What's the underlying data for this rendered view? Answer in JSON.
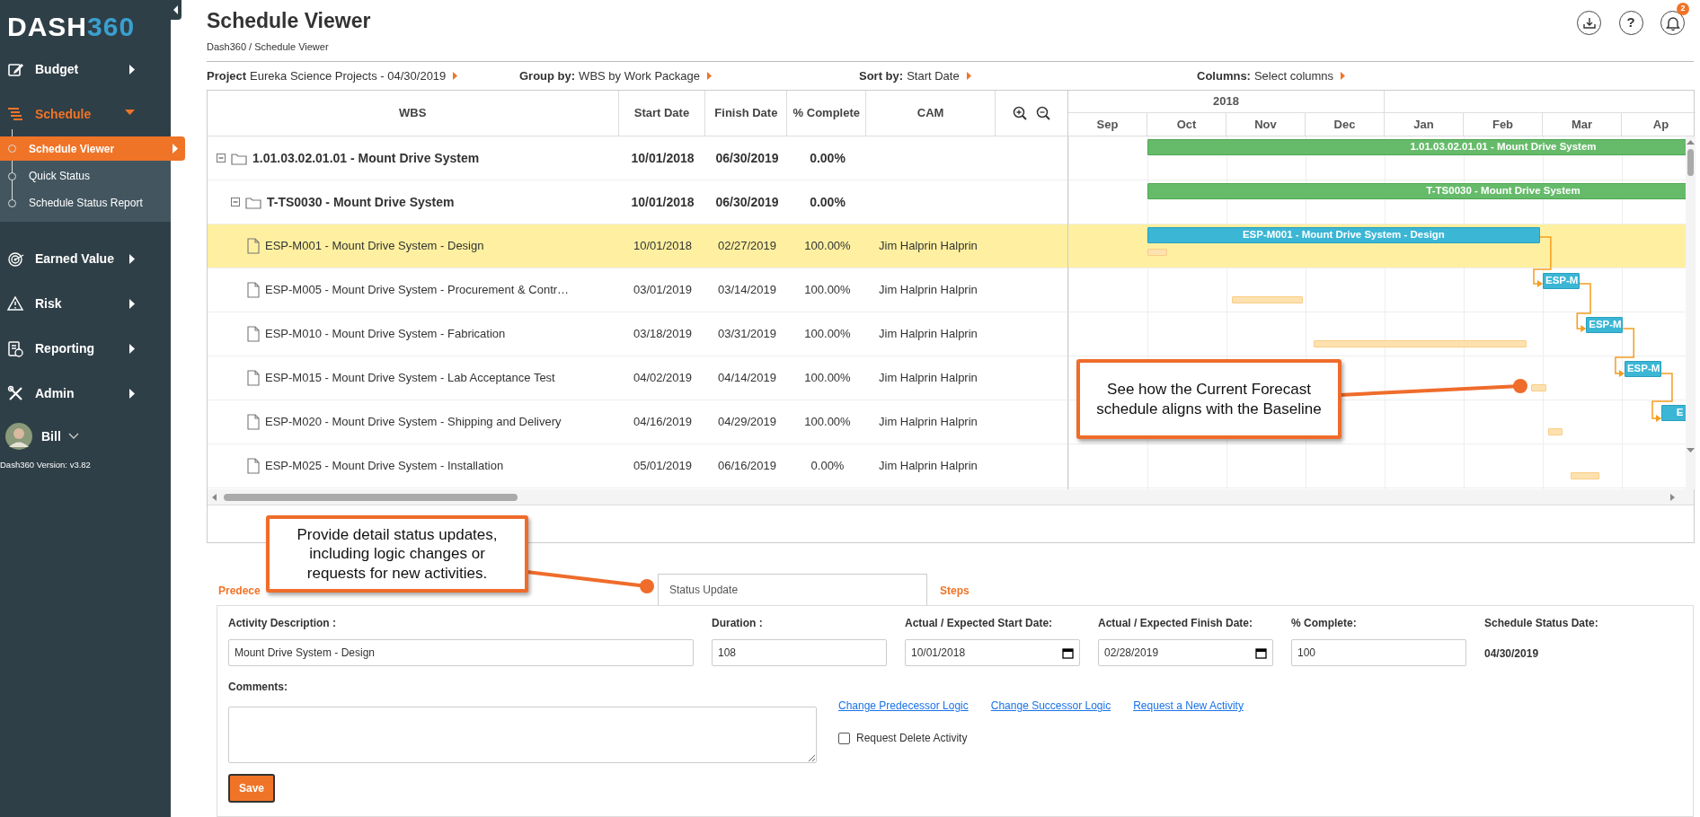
{
  "sidebar": {
    "logo": {
      "text": "DASH",
      "accent": "360"
    },
    "items": [
      {
        "label": "Budget",
        "expanded": false
      },
      {
        "label": "Schedule",
        "expanded": true,
        "children": [
          {
            "label": "Schedule Viewer",
            "selected": true
          },
          {
            "label": "Quick Status",
            "selected": false
          },
          {
            "label": "Schedule Status Report",
            "selected": false
          }
        ]
      },
      {
        "label": "Earned Value",
        "expanded": false
      },
      {
        "label": "Risk",
        "expanded": false
      },
      {
        "label": "Reporting",
        "expanded": false
      },
      {
        "label": "Admin",
        "expanded": false
      }
    ],
    "user": {
      "name": "Bill"
    },
    "version": "Dash360 Version: v3.82"
  },
  "header": {
    "title": "Schedule Viewer",
    "breadcrumb": "Dash360 / Schedule Viewer",
    "help": "?",
    "notification_count": "2"
  },
  "toolbar": [
    {
      "label": "Project",
      "value": "Eureka Science Projects - 04/30/2019"
    },
    {
      "label": "Group by:",
      "value": "WBS by Work Package"
    },
    {
      "label": "Sort by:",
      "value": "Start Date"
    },
    {
      "label": "Columns:",
      "value": "Select columns"
    }
  ],
  "grid": {
    "columns": [
      "WBS",
      "Start Date",
      "Finish Date",
      "% Complete",
      "CAM"
    ],
    "timeline": {
      "year": "2018",
      "months": [
        "Sep",
        "Oct",
        "Nov",
        "Dec",
        "Jan",
        "Feb",
        "Mar",
        "Ap"
      ]
    },
    "rows": [
      {
        "kind": "group",
        "wbs": "1.01.03.02.01.01 - Mount Drive System",
        "start": "10/01/2018",
        "finish": "06/30/2019",
        "complete": "0.00%",
        "expanded": true,
        "selected": false,
        "bar_label": "1.01.03.02.01.01 - Mount Drive System",
        "children": [
          {
            "kind": "group",
            "wbs": "T-TS0030 - Mount Drive System",
            "start": "10/01/2018",
            "finish": "06/30/2019",
            "complete": "0.00%",
            "expanded": true,
            "selected": false,
            "bar_label": "T-TS0030 - Mount Drive System",
            "children": [
              {
                "kind": "task",
                "wbs": "ESP-M001 - Mount Drive System - Design",
                "start": "10/01/2018",
                "finish": "02/27/2019",
                "complete": "100.00%",
                "cam": "Jim Halprin Halprin",
                "selected": true,
                "bar_label": "ESP-M001 - Mount Drive System - Design"
              },
              {
                "kind": "task",
                "wbs": "ESP-M005 - Mount Drive System - Procurement & Contr…",
                "start": "03/01/2019",
                "finish": "03/14/2019",
                "complete": "100.00%",
                "cam": "Jim Halprin Halprin",
                "selected": false,
                "bar_label": "ESP-M"
              },
              {
                "kind": "task",
                "wbs": "ESP-M010 - Mount Drive System - Fabrication",
                "start": "03/18/2019",
                "finish": "03/31/2019",
                "complete": "100.00%",
                "cam": "Jim Halprin Halprin",
                "selected": false,
                "bar_label": "ESP-M"
              },
              {
                "kind": "task",
                "wbs": "ESP-M015 - Mount Drive System - Lab Acceptance Test",
                "start": "04/02/2019",
                "finish": "04/14/2019",
                "complete": "100.00%",
                "cam": "Jim Halprin Halprin",
                "selected": false,
                "bar_label": "ESP-M"
              },
              {
                "kind": "task",
                "wbs": "ESP-M020 - Mount Drive System - Shipping and Delivery",
                "start": "04/16/2019",
                "finish": "04/29/2019",
                "complete": "100.00%",
                "cam": "Jim Halprin Halprin",
                "selected": false,
                "bar_label": "E"
              },
              {
                "kind": "task",
                "wbs": "ESP-M025 - Mount Drive System - Installation",
                "start": "05/01/2019",
                "finish": "06/16/2019",
                "complete": "0.00%",
                "cam": "Jim Halprin Halprin",
                "selected": false
              }
            ]
          }
        ]
      }
    ]
  },
  "tabs": [
    {
      "label": "Predece",
      "selected": false
    },
    {
      "label": "Status Update",
      "selected": true
    },
    {
      "label": "Steps",
      "selected": false
    }
  ],
  "form": {
    "fields": [
      {
        "kind": "text",
        "label": "Activity Description :",
        "value": "Mount Drive System - Design"
      },
      {
        "kind": "text",
        "label": "Duration :",
        "value": "108"
      },
      {
        "kind": "date",
        "label": "Actual / Expected Start Date:",
        "value": "10/01/2018"
      },
      {
        "kind": "date",
        "label": "Actual / Expected Finish Date:",
        "value": "02/28/2019"
      },
      {
        "kind": "text",
        "label": "% Complete:",
        "value": "100"
      },
      {
        "kind": "static",
        "label": "Schedule Status Date:",
        "value": "04/30/2019"
      }
    ],
    "comments_label": "Comments:",
    "links": [
      "Change Predecessor Logic",
      "Change Successor Logic",
      "Request a New Activity"
    ],
    "delete_request": {
      "label": "Request Delete Activity",
      "checked": false
    },
    "save": "Save"
  },
  "callouts": [
    {
      "text": "See how the Current Forecast schedule aligns with the Baseline"
    },
    {
      "text": "Provide detail status updates, including logic changes or requests for new activities."
    }
  ]
}
